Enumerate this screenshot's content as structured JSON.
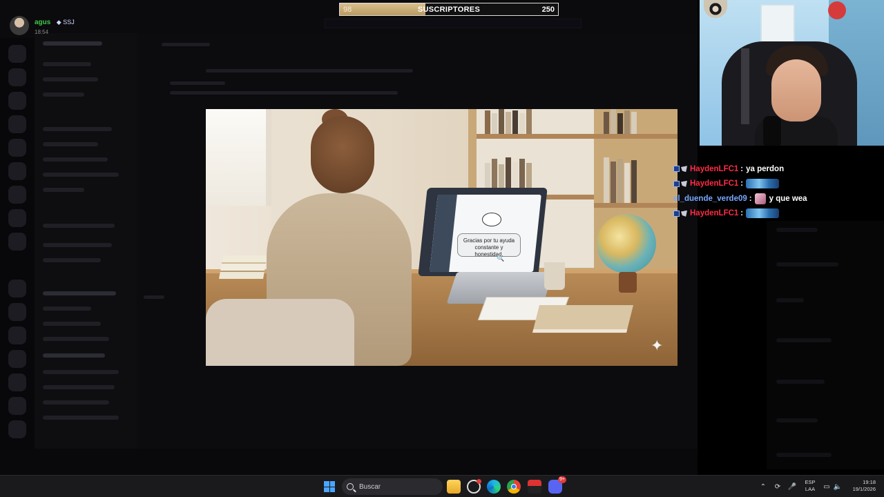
{
  "user_card": {
    "name": "agus",
    "badge": "SSJ",
    "time": "18:54"
  },
  "subscriber_goal": {
    "current": "98",
    "title": "SUSCRIPTORES",
    "goal": "250",
    "progress_fraction": 0.392
  },
  "main_image": {
    "bubble_text": "Gracias por tu ayuda constante y honestidad."
  },
  "chat": {
    "messages": [
      {
        "user": "HaydenLFC1",
        "sep": ":",
        "text": "ya perdon",
        "emote": false
      },
      {
        "user": "HaydenLFC1",
        "sep": ":",
        "text": "",
        "emote": true
      },
      {
        "user": "el_duende_verde09",
        "sep": ":",
        "text": "y que wea",
        "emote": false
      },
      {
        "user": "HaydenLFC1",
        "sep": ":",
        "text": "",
        "emote": true
      }
    ]
  },
  "taskbar": {
    "search_placeholder": "Buscar",
    "lang_line1": "ESP",
    "lang_line2": "LAA",
    "clock_time": "19:18",
    "clock_date": "19/1/2026",
    "discord_badge": "9+"
  },
  "colors": {
    "chat_user_red": "#ff2b44",
    "chat_user_blue": "#78a8ff",
    "sub_fill": "#c9ab73",
    "taskbar_bg": "#1a1a1d"
  },
  "icons": {
    "start": "windows-start-icon",
    "search": "search-icon",
    "file_explorer": "folder-icon",
    "edge": "edge-icon",
    "chrome": "chrome-icon",
    "discord": "discord-icon"
  }
}
